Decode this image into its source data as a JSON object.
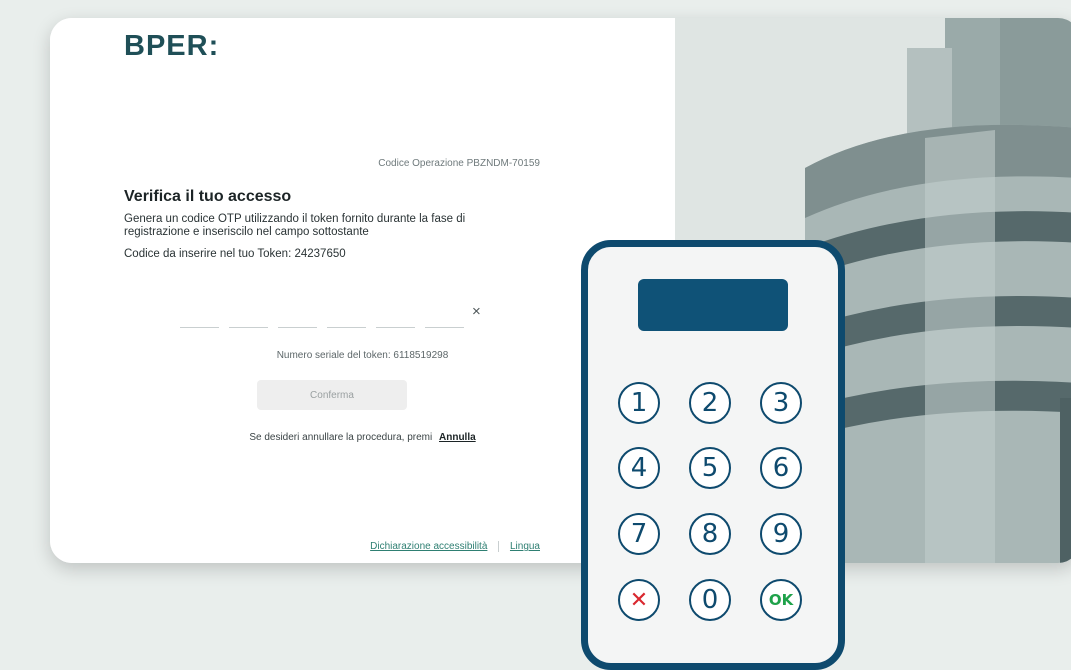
{
  "brand": {
    "logo_text": "BPER:"
  },
  "operation": {
    "code_label": "Codice Operazione PBZNDM-70159"
  },
  "verify": {
    "title": "Verifica il tuo accesso",
    "description": "Genera un codice OTP utilizzando il token fornito durante la fase di registrazione e inseriscilo nel campo sottostante",
    "code_to_enter": "Codice da inserire nel tuo Token: 24237650"
  },
  "otp": {
    "slot_count": 6,
    "clear_label": "×"
  },
  "token_serial": "Numero seriale del token: 6118519298",
  "confirm_button": "Conferma",
  "cancel": {
    "text": "Se desideri annullare la procedura, premi",
    "link": "Annulla"
  },
  "footer": {
    "accessibility": "Dichiarazione accessibilità",
    "language": "Lingua"
  },
  "token_device": {
    "keys": [
      {
        "label": "1",
        "type": "digit"
      },
      {
        "label": "2",
        "type": "digit"
      },
      {
        "label": "3",
        "type": "digit"
      },
      {
        "label": "4",
        "type": "digit"
      },
      {
        "label": "5",
        "type": "digit"
      },
      {
        "label": "6",
        "type": "digit"
      },
      {
        "label": "7",
        "type": "digit"
      },
      {
        "label": "8",
        "type": "digit"
      },
      {
        "label": "9",
        "type": "digit"
      },
      {
        "label": "✕",
        "type": "cancel"
      },
      {
        "label": "0",
        "type": "digit"
      },
      {
        "label": "OK",
        "type": "ok"
      }
    ]
  },
  "colors": {
    "brand": "#1f4f57",
    "token_frame": "#0e4a6e",
    "token_screen": "#0f5277",
    "link": "#2e7f72",
    "cancel_key": "#d9282f",
    "ok_key": "#1fa24a"
  }
}
